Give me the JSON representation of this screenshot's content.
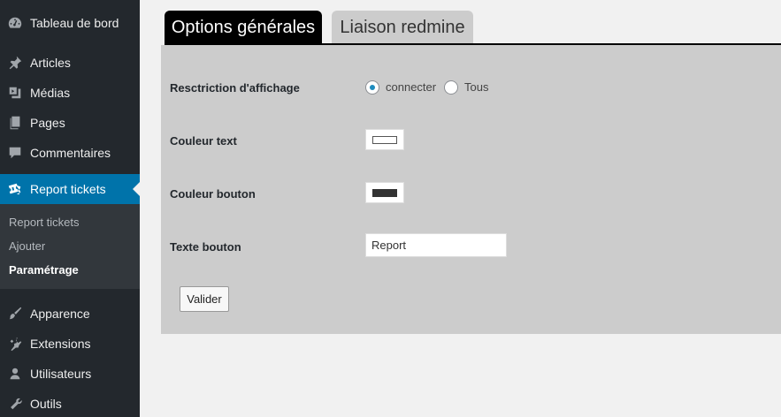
{
  "sidebar": {
    "items": [
      {
        "label": "Tableau de bord",
        "icon": "dashboard-icon"
      },
      {
        "label": "Articles",
        "icon": "pushpin-icon"
      },
      {
        "label": "Médias",
        "icon": "media-icon"
      },
      {
        "label": "Pages",
        "icon": "pages-icon"
      },
      {
        "label": "Commentaires",
        "icon": "comment-icon"
      },
      {
        "label": "Report tickets",
        "icon": "tickets-icon"
      },
      {
        "label": "Apparence",
        "icon": "brush-icon"
      },
      {
        "label": "Extensions",
        "icon": "plugin-icon"
      },
      {
        "label": "Utilisateurs",
        "icon": "user-icon"
      },
      {
        "label": "Outils",
        "icon": "wrench-icon"
      }
    ],
    "submenu": [
      {
        "label": "Report tickets"
      },
      {
        "label": "Ajouter"
      },
      {
        "label": "Paramétrage"
      }
    ],
    "active_color": "#0073aa"
  },
  "tabs": [
    {
      "label": "Options générales",
      "active": true
    },
    {
      "label": "Liaison redmine",
      "active": false
    }
  ],
  "form": {
    "restriction": {
      "label": "Resctriction d'affichage",
      "options": [
        "connecter",
        "Tous"
      ],
      "selected": "connecter"
    },
    "text_color": {
      "label": "Couleur text",
      "value": "#ffffff"
    },
    "button_color": {
      "label": "Couleur bouton",
      "value": "#333333"
    },
    "button_text": {
      "label": "Texte bouton",
      "value": "Report"
    },
    "submit_label": "Valider"
  }
}
